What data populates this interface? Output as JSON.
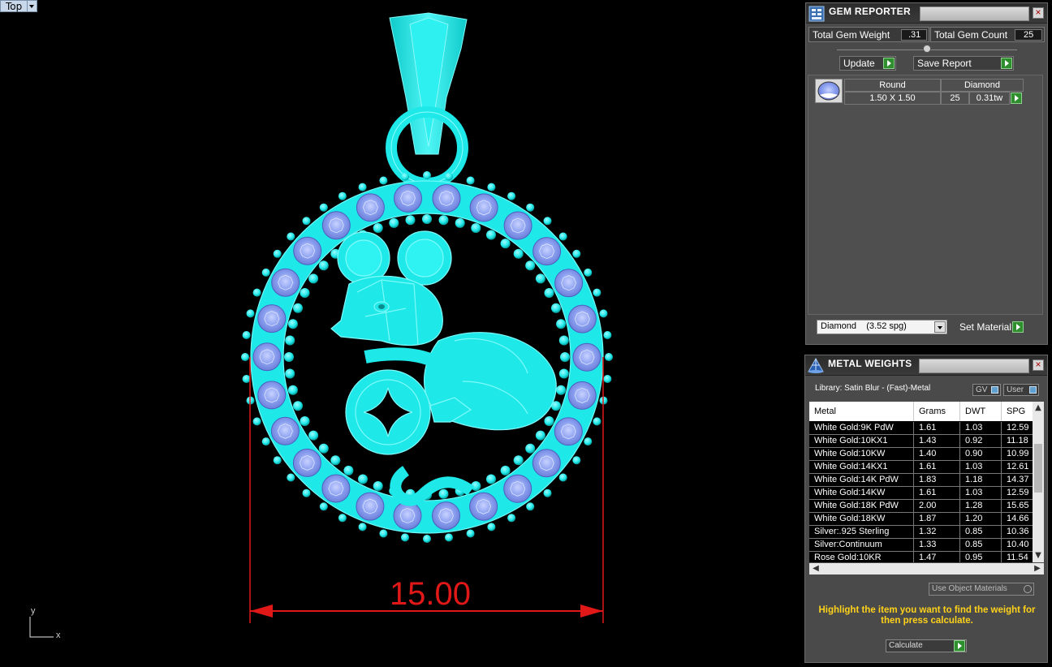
{
  "viewport": {
    "name": "Top",
    "dimension": "15.00",
    "axis_y": "y",
    "axis_x": "x"
  },
  "gem_reporter": {
    "title": "GEM REPORTER",
    "total_weight_label": "Total Gem Weight",
    "total_weight_value": ".31",
    "total_count_label": "Total Gem Count",
    "total_count_value": "25",
    "update_label": "Update",
    "save_report_label": "Save Report",
    "gem": {
      "shape": "Round",
      "type": "Diamond",
      "size": "1.50 X 1.50",
      "count": "25",
      "weight": "0.31tw"
    },
    "material_select": "Diamond    (3.52 spg)",
    "set_material_label": "Set Material"
  },
  "metal_weights": {
    "title": "METAL WEIGHTS",
    "library": "Library: Satin Blur - (Fast)-Metal",
    "gv_label": "GV",
    "user_label": "User",
    "columns": [
      "Metal",
      "Grams",
      "DWT",
      "SPG"
    ],
    "rows": [
      [
        "White Gold:9K PdW",
        "1.61",
        "1.03",
        "12.59"
      ],
      [
        "White Gold:10KX1",
        "1.43",
        "0.92",
        "11.18"
      ],
      [
        "White Gold:10KW",
        "1.40",
        "0.90",
        "10.99"
      ],
      [
        "White Gold:14KX1",
        "1.61",
        "1.03",
        "12.61"
      ],
      [
        "White Gold:14K PdW",
        "1.83",
        "1.18",
        "14.37"
      ],
      [
        "White Gold:14KW",
        "1.61",
        "1.03",
        "12.59"
      ],
      [
        "White Gold:18K PdW",
        "2.00",
        "1.28",
        "15.65"
      ],
      [
        "White Gold:18KW",
        "1.87",
        "1.20",
        "14.66"
      ],
      [
        "Silver:.925 Sterling",
        "1.32",
        "0.85",
        "10.36"
      ],
      [
        "Silver:Continuum",
        "1.33",
        "0.85",
        "10.40"
      ],
      [
        "Rose Gold:10KR",
        "1.47",
        "0.95",
        "11.54"
      ]
    ],
    "use_object_materials": "Use Object Materials",
    "instruction": "Highlight the item you want to find the weight for then press calculate.",
    "calculate_label": "Calculate"
  },
  "colors": {
    "metal_cyan": "#1ee8e8",
    "gem_blue": "#8a9ff0",
    "dimension_red": "#e01818",
    "instruction_yellow": "#ffd21a",
    "panel_bg": "#4a4a4a"
  }
}
